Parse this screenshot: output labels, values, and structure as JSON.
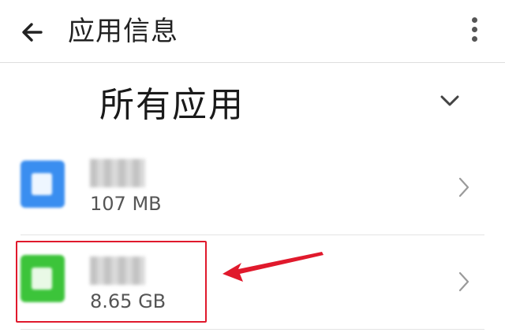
{
  "header": {
    "title": "应用信息",
    "back_icon": "arrow-left-icon",
    "menu_icon": "more-vert-icon"
  },
  "filter": {
    "label": "所有应用",
    "dropdown_icon": "chevron-down-icon"
  },
  "apps": [
    {
      "name": "",
      "size": "107 MB",
      "icon": "app-icon-blue",
      "icon_color": "#3a8ef0"
    },
    {
      "name": "",
      "size": "8.65 GB",
      "icon": "app-icon-green",
      "icon_color": "#3cc43a"
    }
  ],
  "annotation": {
    "color": "#e0192c"
  }
}
